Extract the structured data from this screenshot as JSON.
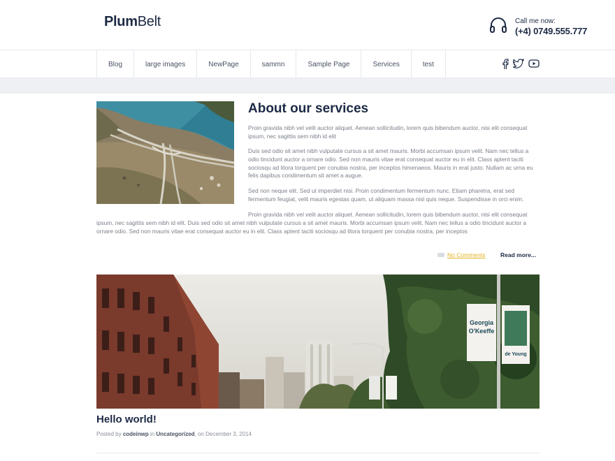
{
  "header": {
    "logo_bold": "Plum",
    "logo_rest": "Belt",
    "call_label": "Call me now:",
    "call_phone": "(+4) 0749.555.777"
  },
  "nav": {
    "items": [
      "Blog",
      "large images",
      "NewPage",
      "sammn",
      "Sample Page",
      "Services",
      "test"
    ]
  },
  "social": [
    "facebook-icon",
    "twitter-icon",
    "youtube-icon"
  ],
  "post1": {
    "title": "About our services",
    "p1": "Proin gravida nibh vel velit auctor aliquet. Aenean sollicitudin, lorem quis bibendum auctor, nisi elit consequat ipsum, nec sagittis sem nibh id elit",
    "p2": "Duis sed odio sit amet nibh vulputate cursus a sit amet mauris. Morbi accumsan ipsum velit. Nam nec tellus a odio tincidunt auctor a ornare odio. Sed non mauris vitae erat consequat auctor eu in elit. Class aptent taciti sociosqu ad litora torquent per conubia nostra, per inceptos himenaeos. Mauris in erat justo. Nullam ac urna eu felis dapibus condimentum sit amet a augue.",
    "p3": "Sed non neque elit. Sed ut imperdiet nisi. Proin condimentum fermentum nunc. Etiam pharetra, erat sed fermentum feugiat, velit mauris egestas quam, ut aliquam massa nisl quis neque. Suspendisse in orci enim.",
    "p4": "Proin gravida nibh vel velit auctor aliquet. Aenean sollicitudin, lorem quis bibendum auctor, nisi elit consequat ipsum, nec sagittis sem nibh id elit. Duis sed odio sit amet nibh vulputate cursus a sit amet mauris. Morbi accumsan ipsum velit. Nam nec tellus a odio tincidunt auctor a ornare odio. Sed non mauris vitae erat consequat auctor eu in elit. Class aptent taciti sociosqu ad litora torquent per conubia nostra, per inceptos",
    "comments": "No Comments",
    "read_more": "Read more..."
  },
  "post2": {
    "title": "Hello world!",
    "posted_by": "Posted by",
    "author": "codeinwp",
    "in": "in",
    "category": "Uncategorized",
    "date": ", on December 3, 2014",
    "banner1_line1": "Georgia",
    "banner1_line2": "O'Keeffe",
    "banner2_line1": "de Young"
  },
  "colors": {
    "navy": "#1d2a45",
    "gold": "#e2b322",
    "text": "#7a7f88"
  }
}
